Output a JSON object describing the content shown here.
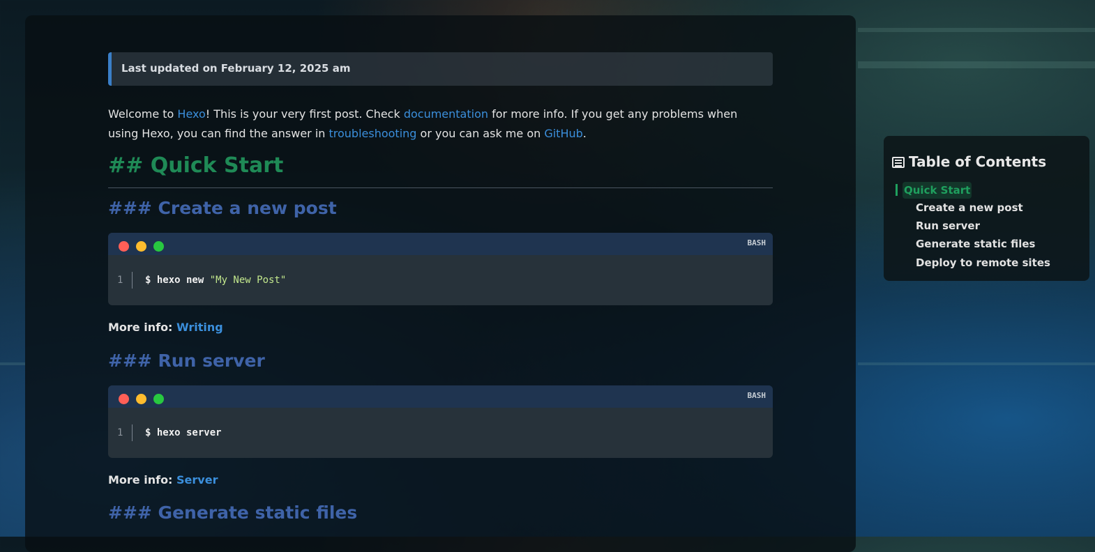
{
  "post": {
    "last_updated": "Last updated on February 12, 2025 am",
    "intro": {
      "p1": "Welcome to ",
      "link1": "Hexo",
      "p2": "! This is your very first post. Check ",
      "link2": "documentation",
      "p3": " for more info. If you get any problems when using Hexo, you can find the answer in ",
      "link3": "troubleshooting",
      "p4": " or you can ask me on ",
      "link4": "GitHub",
      "p5": "."
    },
    "h2_quick_start": "## Quick Start",
    "sections": [
      {
        "heading": "### Create a new post",
        "lang": "BASH",
        "line": "1",
        "cmd_prefix": "$ hexo new ",
        "cmd_string": "\"My New Post\"",
        "more_label": "More info: ",
        "more_link": "Writing"
      },
      {
        "heading": "### Run server",
        "lang": "BASH",
        "line": "1",
        "cmd_prefix": "$ hexo server",
        "cmd_string": "",
        "more_label": "More info: ",
        "more_link": "Server"
      },
      {
        "heading": "### Generate static files"
      }
    ]
  },
  "toc": {
    "title": "Table of Contents",
    "icon": "list-icon",
    "active": "Quick Start",
    "items": [
      "Create a new post",
      "Run server",
      "Generate static files",
      "Deploy to remote sites"
    ]
  },
  "colors": {
    "accent_green": "#1fa05e",
    "link_blue": "#3b8fdc",
    "h3_blue": "#3f63a8",
    "code_header": "#1f3450",
    "dot_red": "#ff5f57",
    "dot_yellow": "#febc2e",
    "dot_green": "#28c840"
  }
}
